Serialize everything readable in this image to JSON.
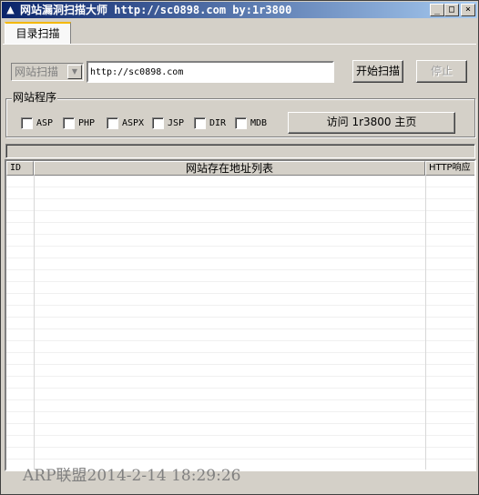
{
  "window": {
    "title": "网站漏洞扫描大师 http://sc0898.com by:1r3800",
    "icon": "app-icon",
    "controls": {
      "minimize": "_",
      "maximize": "□",
      "close": "×"
    }
  },
  "tabs": [
    {
      "label": "目录扫描",
      "active": true
    }
  ],
  "toolbar": {
    "mode_value": "网站扫描",
    "url_value": "http://sc0898.com",
    "start_label": "开始扫描",
    "stop_label": "停止"
  },
  "program_group": {
    "title": "网站程序",
    "options": [
      {
        "label": "ASP",
        "checked": false
      },
      {
        "label": "PHP",
        "checked": false
      },
      {
        "label": "ASPX",
        "checked": false
      },
      {
        "label": "JSP",
        "checked": false
      },
      {
        "label": "DIR",
        "checked": false
      },
      {
        "label": "MDB",
        "checked": false
      }
    ],
    "visit_label": "访问 1r3800 主页"
  },
  "progress": {
    "fraction": 0
  },
  "results": {
    "columns": [
      "ID",
      "网站存在地址列表",
      "HTTP响应"
    ],
    "rows": []
  },
  "status_text": "ARP联盟2014-2-14 18:29:26",
  "colors": {
    "titlebar_start": "#0a246a",
    "titlebar_end": "#a6caf0",
    "tab_accent": "#f4b800",
    "face": "#d4d0c8"
  }
}
